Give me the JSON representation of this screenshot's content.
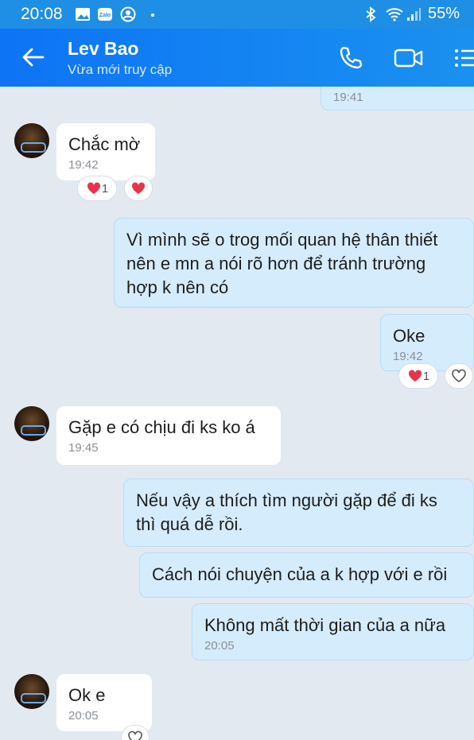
{
  "status_bar": {
    "time": "20:08",
    "battery": "55%"
  },
  "header": {
    "contact_name": "Lev Bao",
    "status": "Vừa mới truy cập"
  },
  "messages": [
    {
      "side": "out",
      "text": "",
      "time": "19:41"
    },
    {
      "side": "in",
      "text": "Chắc mờ",
      "time": "19:42",
      "reaction_count": "1"
    },
    {
      "side": "out",
      "text": "Vì mình sẽ o trog mối quan hệ thân thiết nên e mn a nói rõ hơn để tránh trường hợp k nên có",
      "time": ""
    },
    {
      "side": "out",
      "text": "Oke",
      "time": "19:42",
      "reaction_count": "1"
    },
    {
      "side": "in",
      "text": "Gặp e có chịu đi ks ko á",
      "time": "19:45"
    },
    {
      "side": "out",
      "text": "Nếu vậy a thích tìm người gặp để đi ks thì quá dễ rồi.",
      "time": ""
    },
    {
      "side": "out",
      "text": "Cách nói chuyện của a k hợp với e rồi",
      "time": ""
    },
    {
      "side": "out",
      "text": "Không mất thời gian của a nữa",
      "time": "20:05"
    },
    {
      "side": "in",
      "text": "Ok e",
      "time": "20:05"
    }
  ]
}
